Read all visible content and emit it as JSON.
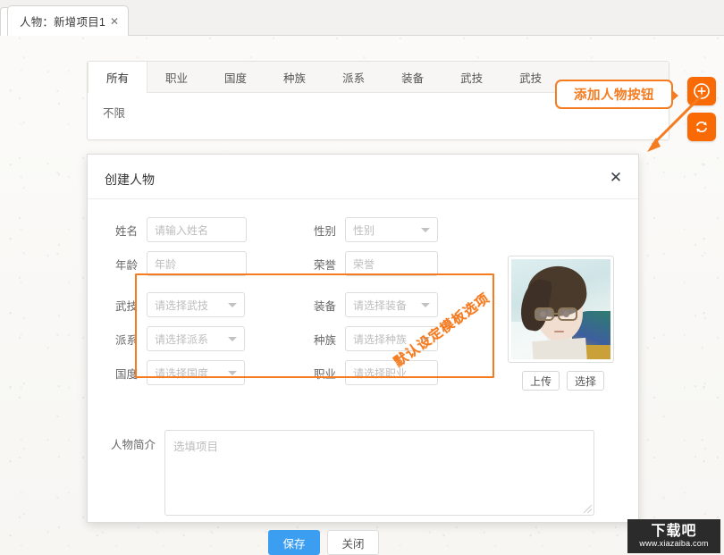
{
  "browser": {
    "tab_title": "人物：新增项目1",
    "tab_close": "✕"
  },
  "filter_panel": {
    "tabs": [
      {
        "label": "所有",
        "active": true
      },
      {
        "label": "职业",
        "active": false
      },
      {
        "label": "国度",
        "active": false
      },
      {
        "label": "种族",
        "active": false
      },
      {
        "label": "派系",
        "active": false
      },
      {
        "label": "装备",
        "active": false
      },
      {
        "label": "武技",
        "active": false
      },
      {
        "label": "武技",
        "active": false
      }
    ],
    "sub_filter": "不限"
  },
  "side_buttons": [
    {
      "name": "add-character-button",
      "icon": "plus-circle-icon",
      "color": "#f96a05"
    },
    {
      "name": "refresh-button",
      "icon": "refresh-icon",
      "color": "#f96a05"
    }
  ],
  "annotations": {
    "callout_label": "添加人物按钮",
    "diagonal_note": "默认设定模板选项",
    "accent_color": "#f47b20"
  },
  "dialog": {
    "title": "创建人物",
    "close_label": "✕",
    "fields": [
      {
        "label": "姓名",
        "placeholder": "请输入姓名",
        "type": "text"
      },
      {
        "label": "性别",
        "placeholder": "性别",
        "type": "select"
      },
      {
        "label": "年龄",
        "placeholder": "年龄",
        "type": "text"
      },
      {
        "label": "荣誉",
        "placeholder": "荣誉",
        "type": "text"
      },
      {
        "label": "武技",
        "placeholder": "请选择武技",
        "type": "select"
      },
      {
        "label": "装备",
        "placeholder": "请选择装备",
        "type": "select"
      },
      {
        "label": "派系",
        "placeholder": "请选择派系",
        "type": "select"
      },
      {
        "label": "种族",
        "placeholder": "请选择种族",
        "type": "select"
      },
      {
        "label": "国度",
        "placeholder": "请选择国度",
        "type": "select"
      },
      {
        "label": "职业",
        "placeholder": "请选择职业",
        "type": "select"
      }
    ],
    "avatar": {
      "upload_label": "上传",
      "choose_label": "选择"
    },
    "bio": {
      "label": "人物简介",
      "placeholder": "选填项目"
    },
    "footer": {
      "save_label": "保存",
      "close_label": "关闭",
      "save_color": "#3c9ef0"
    }
  },
  "watermark": {
    "logo": "下载吧",
    "url": "www.xiazaiba.com"
  }
}
